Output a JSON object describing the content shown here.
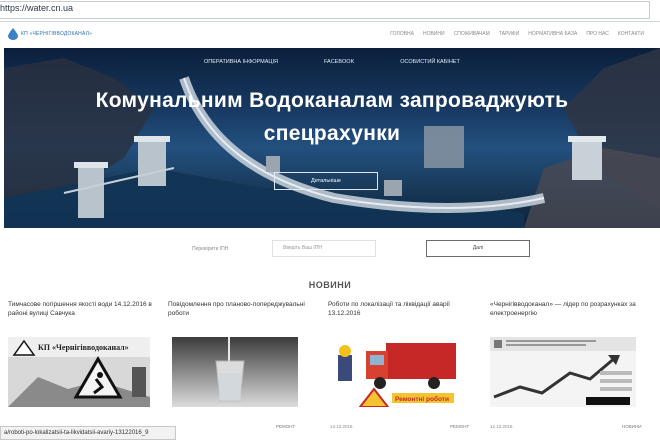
{
  "browser": {
    "url": "https://water.cn.ua"
  },
  "header": {
    "logo_text": "КП «ЧЕРНІГІВВОДОКАНАЛ»",
    "nav": [
      "Головна",
      "Новини",
      "Споживачам",
      "Тарифи",
      "Нормативна база",
      "Про нас",
      "Контакти"
    ]
  },
  "hero": {
    "links": [
      "Оперативна інформація",
      "Facebook",
      "Особистий кабінет"
    ],
    "title_line1": "Комунальним Водоканалам запроваджують",
    "title_line2": "спецрахунки",
    "button": "Детальніше"
  },
  "search": {
    "label": "Перевірити ІПН",
    "placeholder": "Введіть Ваш ІПН",
    "button": "Далі"
  },
  "news": {
    "heading": "НОВИНИ",
    "items": [
      {
        "title": "Тимчасове погіршення якості води 14.12.2016 в районі вулиці Савчука",
        "date": "",
        "more": ""
      },
      {
        "title": "Повідомлення про планово-попереджувальні роботи",
        "date": "",
        "more": "РЕМОНТ"
      },
      {
        "title": "Роботи по локалізації та ліквідації аварії 13.12.2016",
        "date": "13.12.2016",
        "more": "РЕМОНТ"
      },
      {
        "title": "«Чернігівводоканал» — лідер по розрахунках за електроенергію",
        "date": "12.12.2016",
        "more": "НОВИНИ"
      }
    ],
    "image1_caption": "КП «Чернігівводоканал»",
    "image3_caption": "Ремонтні роботи"
  },
  "status_bar": {
    "url": "a/roboti-po-lokalizatsii-ta-likvidatsii-avariy-13122016_9"
  },
  "colors": {
    "brand": "#2b6fae",
    "hero_dark": "#0b1f3c"
  }
}
